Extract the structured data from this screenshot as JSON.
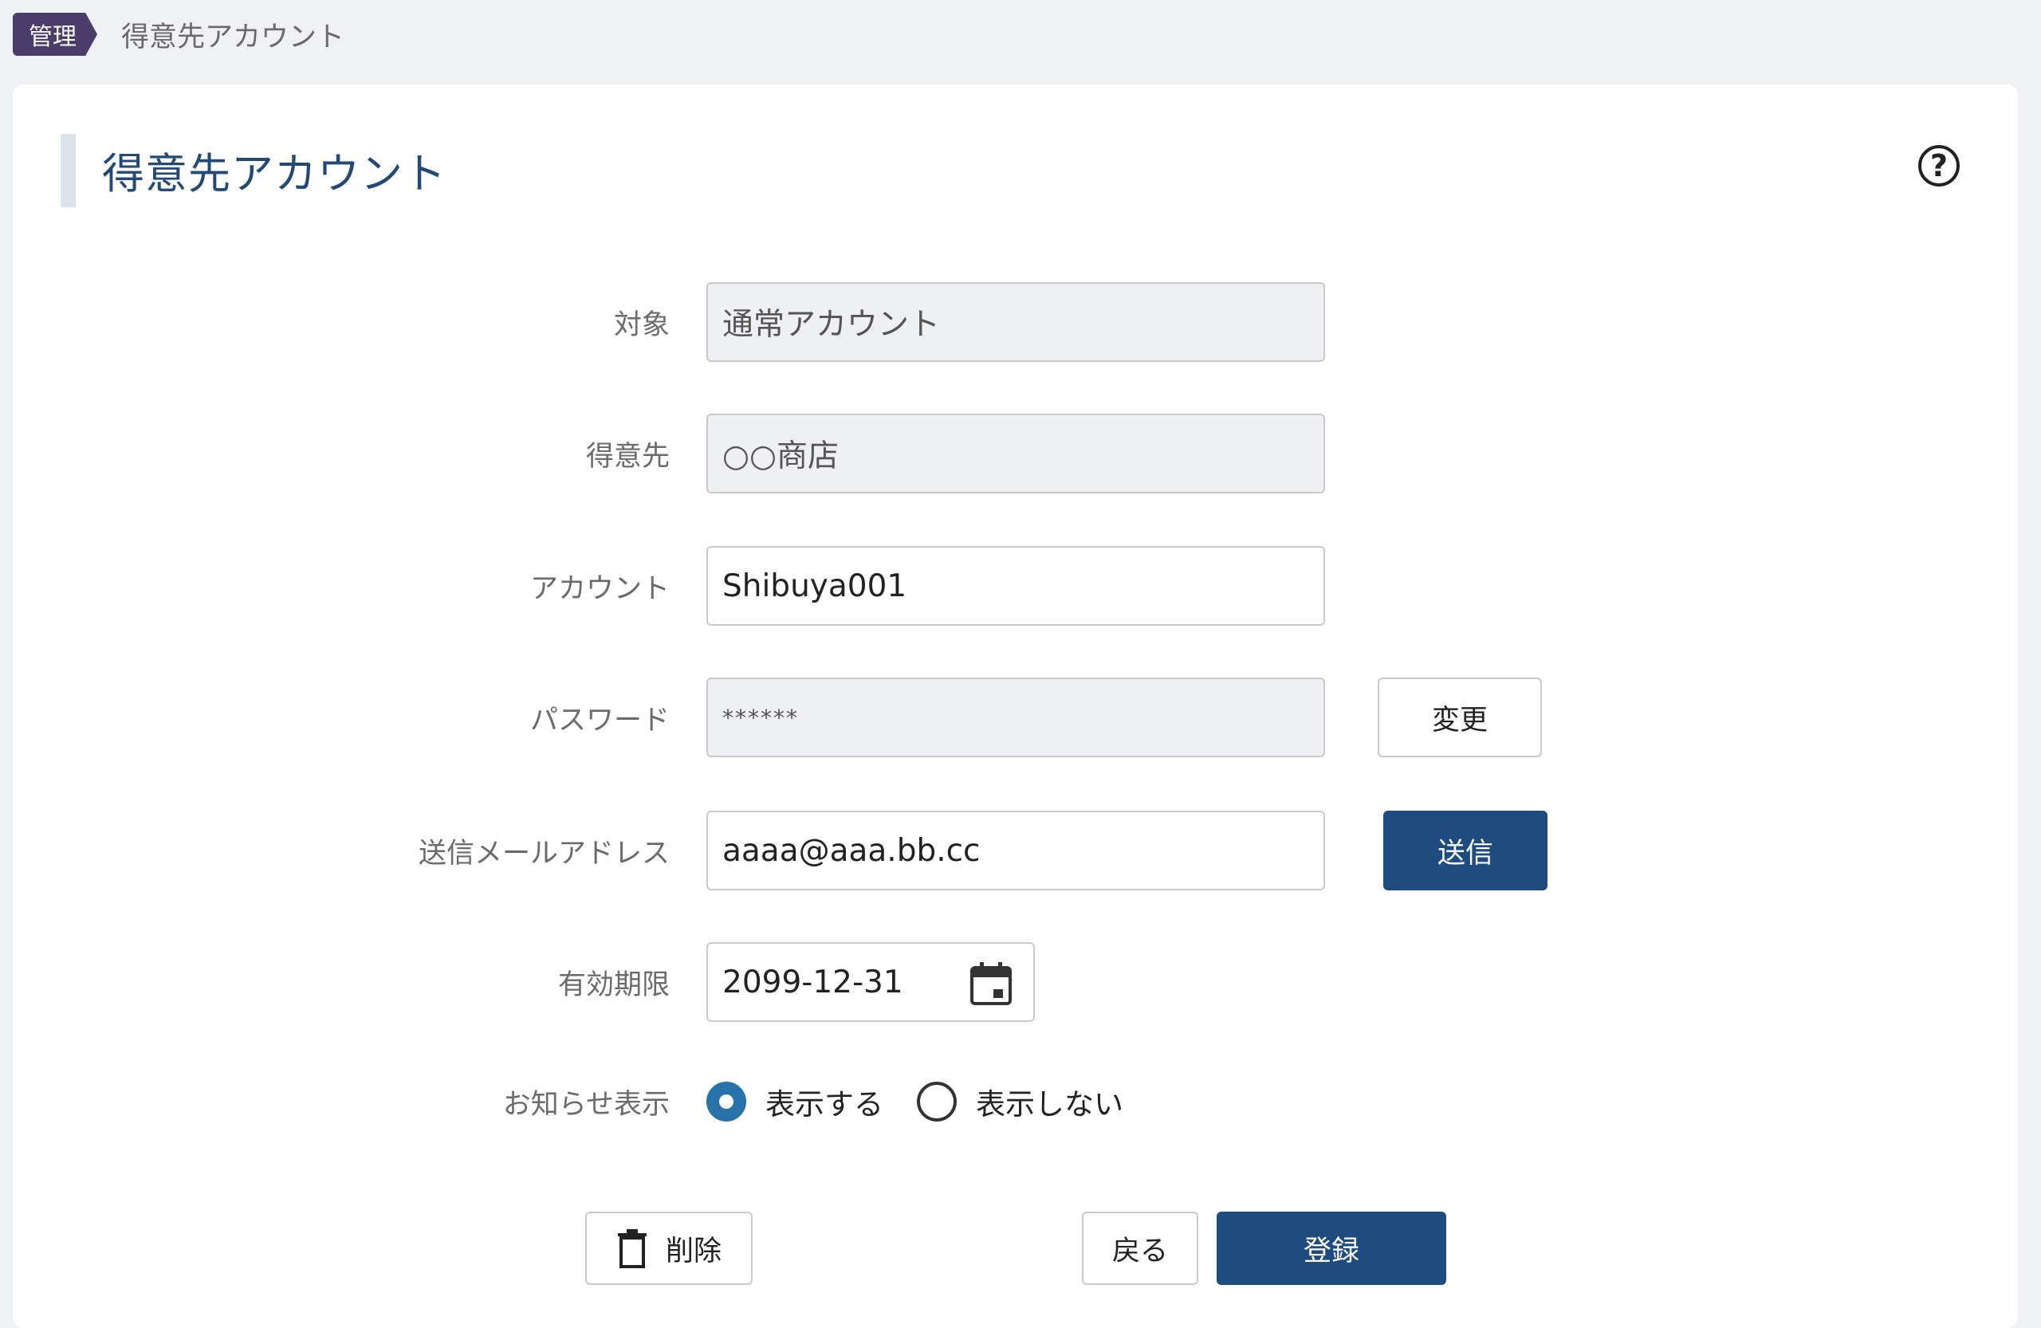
{
  "breadcrumb": {
    "section": "管理",
    "current": "得意先アカウント"
  },
  "page": {
    "title": "得意先アカウント"
  },
  "form": {
    "target": {
      "label": "対象",
      "value": "通常アカウント"
    },
    "customer": {
      "label": "得意先",
      "value": "○○商店"
    },
    "account": {
      "label": "アカウント",
      "value": "Shibuya001"
    },
    "password": {
      "label": "パスワード",
      "value": "******",
      "change_label": "変更"
    },
    "email": {
      "label": "送信メールアドレス",
      "value": "aaaa@aaa.bb.cc",
      "send_label": "送信"
    },
    "expiry": {
      "label": "有効期限",
      "value": "2099-12-31"
    },
    "notice": {
      "label": "お知らせ表示",
      "options": [
        {
          "label": "表示する",
          "selected": true
        },
        {
          "label": "表示しない",
          "selected": false
        }
      ]
    }
  },
  "actions": {
    "delete_label": "削除",
    "back_label": "戻る",
    "register_label": "登録"
  },
  "icons": [
    "help-icon",
    "calendar-icon",
    "trash-icon"
  ],
  "colors": {
    "primary": "#1e4c80",
    "radio_accent": "#2872ab",
    "breadcrumb_tag": "#4a3c6b",
    "title": "#234a74"
  }
}
